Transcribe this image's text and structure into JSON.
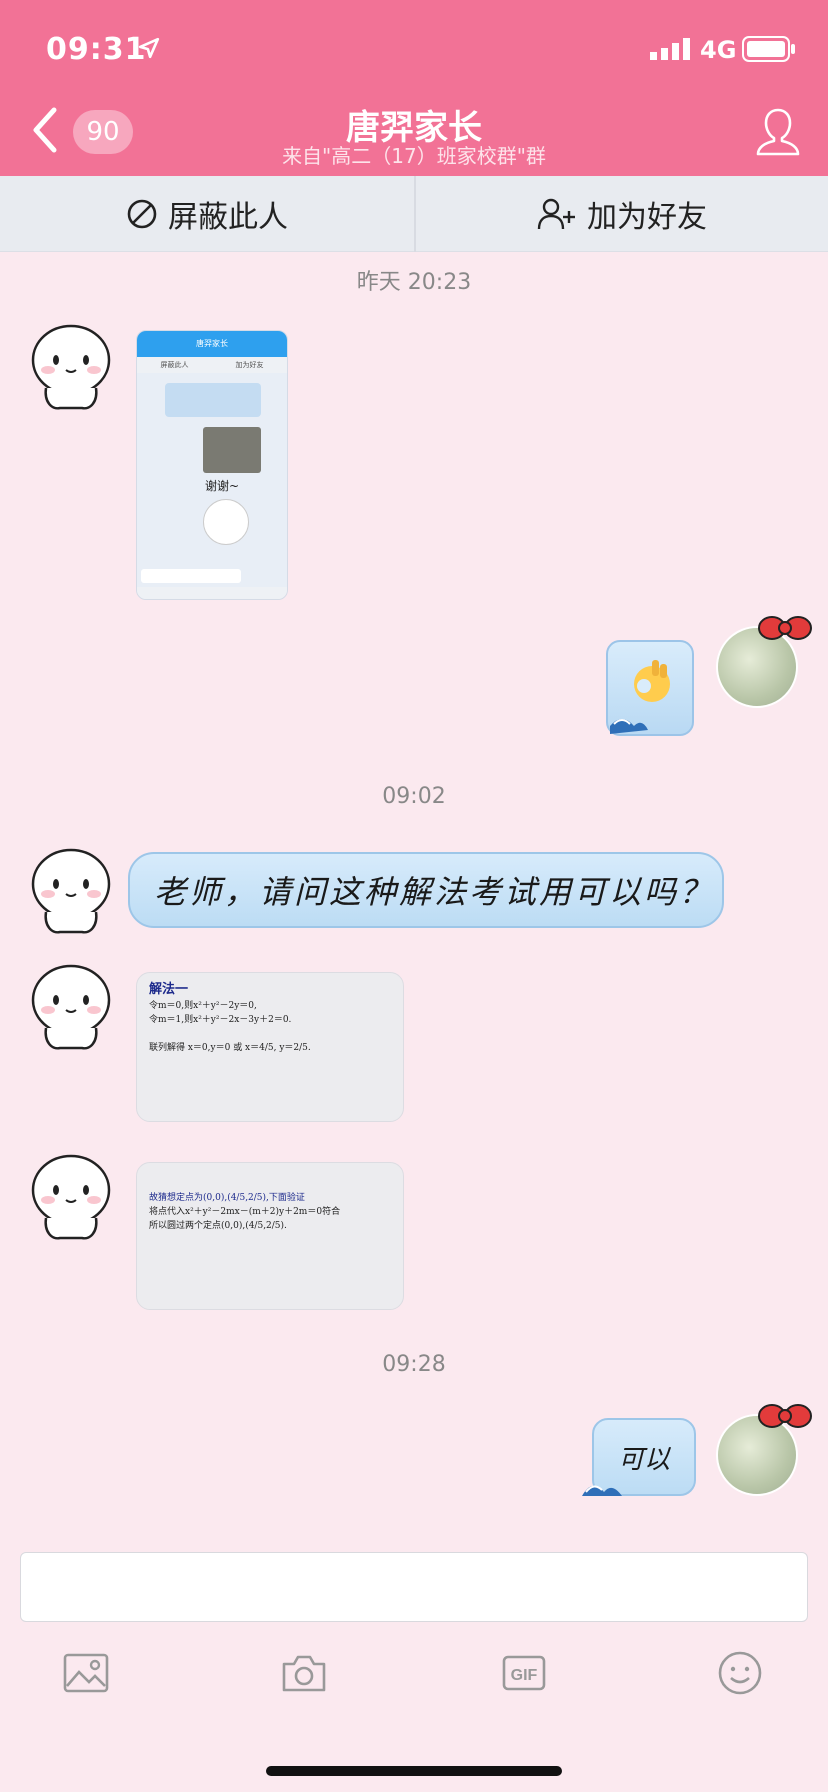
{
  "status_bar": {
    "time": "09:31",
    "network": "4G"
  },
  "header": {
    "unread_badge": "90",
    "title": "唐羿家长",
    "subtitle": "来自\"高二（17）班家校群\"群"
  },
  "actions": {
    "block": "屏蔽此人",
    "add_friend": "加为好友"
  },
  "timestamps": [
    "昨天 20:23",
    "09:02",
    "09:28"
  ],
  "messages": {
    "screenshot": {
      "header": "唐羿家长",
      "bar_left": "屏蔽此人",
      "bar_right": "加为好友",
      "text": "谢谢~"
    },
    "question": "老师，请问这种解法考试用可以吗？",
    "math1": {
      "title": "解法一",
      "line1": "令m＝0,则x²＋y²－2y＝0,",
      "line2": "令m＝1,则x²＋y²－2x－3y＋2＝0.",
      "line3": "联列解得 x＝0,y＝0 或 x＝4/5, y＝2/5."
    },
    "math2": {
      "line1": "故猜想定点为(0,0),(4/5,2/5),下面验证",
      "line2": "将点代入x²＋y²－2mx－(m＋2)y＋2m＝0符合",
      "line3": "所以圆过两个定点(0,0),(4/5,2/5)."
    },
    "reply": "可以"
  },
  "toolbar": [
    "image-icon",
    "camera-icon",
    "gif-icon",
    "emoji-icon"
  ],
  "colors": {
    "header": "#f27296",
    "background": "#fbe9ef",
    "bubble": "#c9e2f7"
  }
}
